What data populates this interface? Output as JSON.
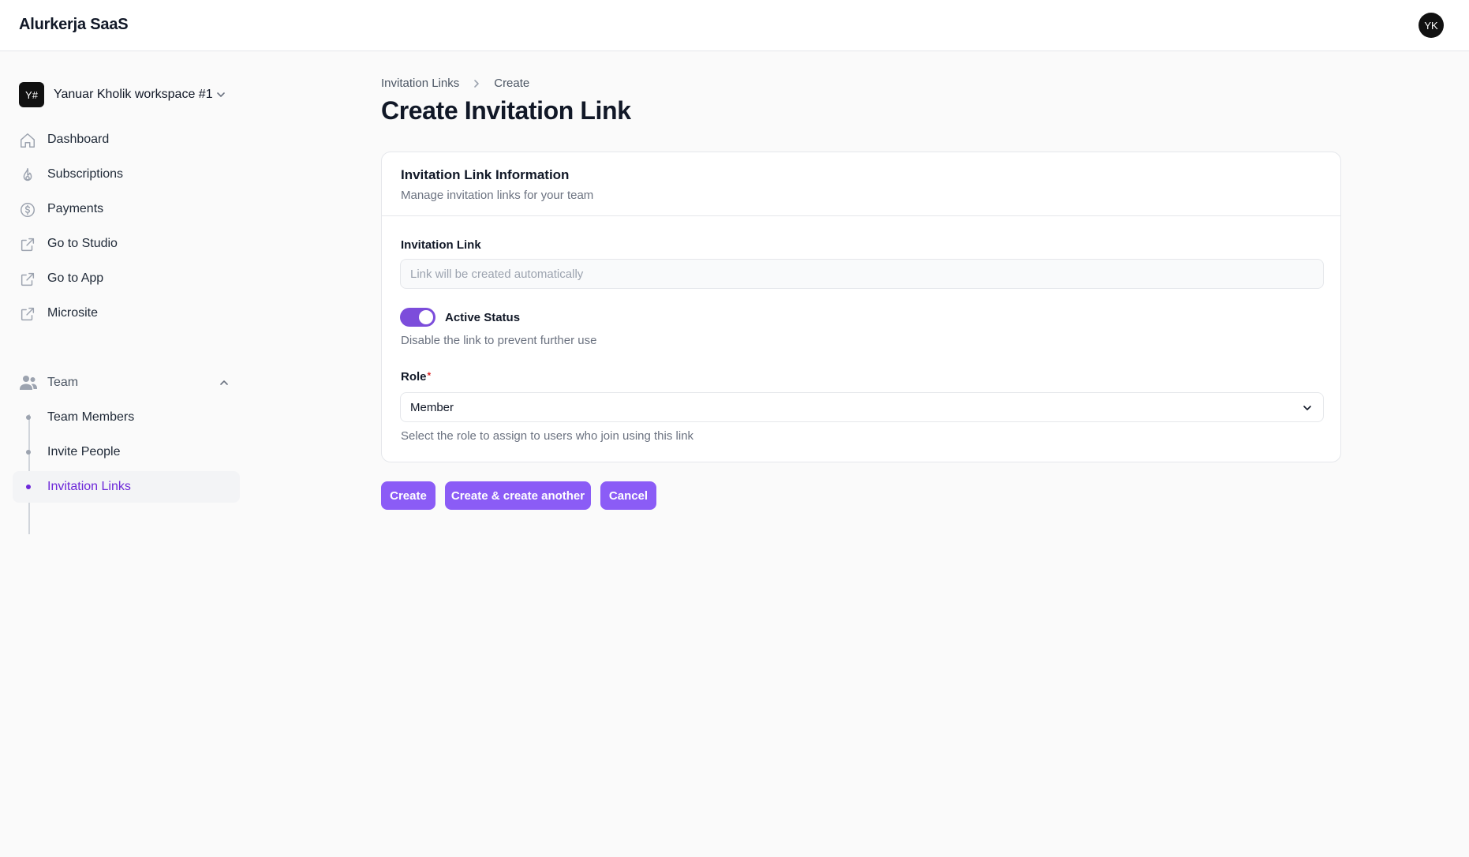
{
  "app": {
    "title": "Alurkerja SaaS",
    "user_initials": "YK"
  },
  "workspace": {
    "initials": "Y#",
    "name": "Yanuar Kholik workspace #1"
  },
  "sidebar": {
    "items": [
      {
        "label": "Dashboard",
        "icon": "home-icon"
      },
      {
        "label": "Subscriptions",
        "icon": "fire-icon"
      },
      {
        "label": "Payments",
        "icon": "dollar-circle-icon"
      },
      {
        "label": "Go to Studio",
        "icon": "external-link-icon"
      },
      {
        "label": "Go to App",
        "icon": "external-link-icon"
      },
      {
        "label": "Microsite",
        "icon": "external-link-icon"
      }
    ],
    "group": {
      "label": "Team",
      "icon": "users-icon",
      "items": [
        {
          "label": "Team Members"
        },
        {
          "label": "Invite People"
        },
        {
          "label": "Invitation Links",
          "active": true
        }
      ]
    }
  },
  "breadcrumb": [
    "Invitation Links",
    "Create"
  ],
  "page": {
    "title": "Create Invitation Link"
  },
  "card": {
    "title": "Invitation Link Information",
    "subtitle": "Manage invitation links for your team",
    "invitation_link": {
      "label": "Invitation Link",
      "placeholder": "Link will be created automatically",
      "value": ""
    },
    "active_status": {
      "label": "Active Status",
      "enabled": true,
      "help": "Disable the link to prevent further use"
    },
    "role": {
      "label": "Role",
      "required_marker": "*",
      "value": "Member",
      "help": "Select the role to assign to users who join using this link"
    }
  },
  "actions": {
    "create": "Create",
    "create_another": "Create & create another",
    "cancel": "Cancel"
  },
  "colors": {
    "accent": "#8b5cf6",
    "toggle_on": "#7c4ddb",
    "active_nav": "#6d28d9",
    "required": "#dc2626"
  }
}
